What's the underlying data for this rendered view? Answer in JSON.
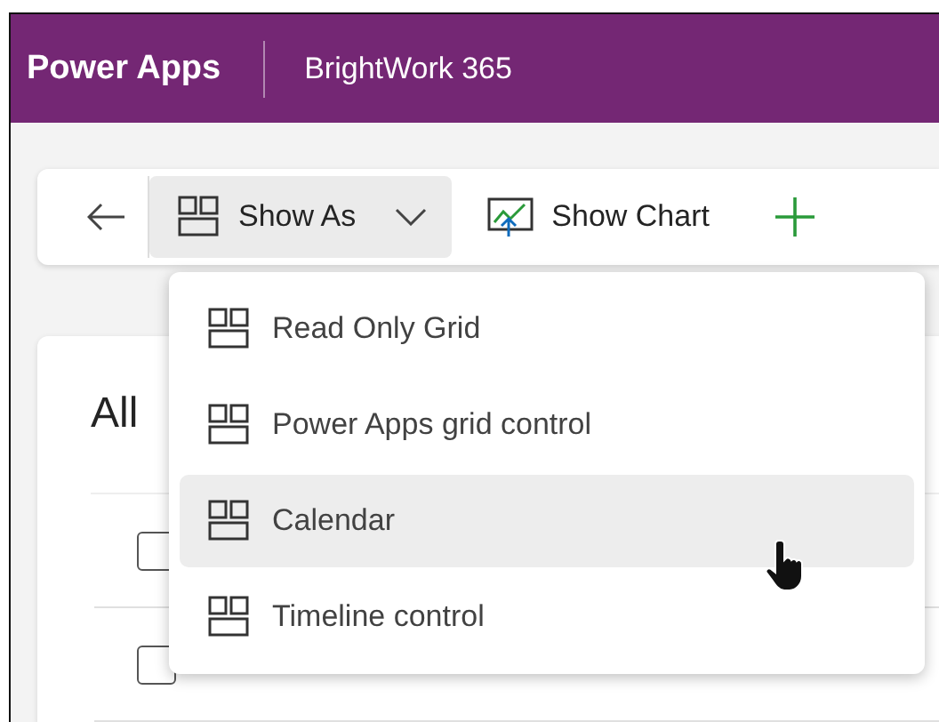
{
  "header": {
    "app_name": "Power Apps",
    "environment": "BrightWork 365"
  },
  "command_bar": {
    "show_as": "Show As",
    "show_chart": "Show Chart"
  },
  "view": {
    "title": "All",
    "rows": [
      {
        "checked": false
      },
      {
        "checked": false
      }
    ]
  },
  "show_as_menu": [
    {
      "label": "Read Only Grid",
      "selected": false
    },
    {
      "label": "Power Apps grid control",
      "selected": false
    },
    {
      "label": "Calendar",
      "selected": true
    },
    {
      "label": "Timeline control",
      "selected": false
    }
  ]
}
